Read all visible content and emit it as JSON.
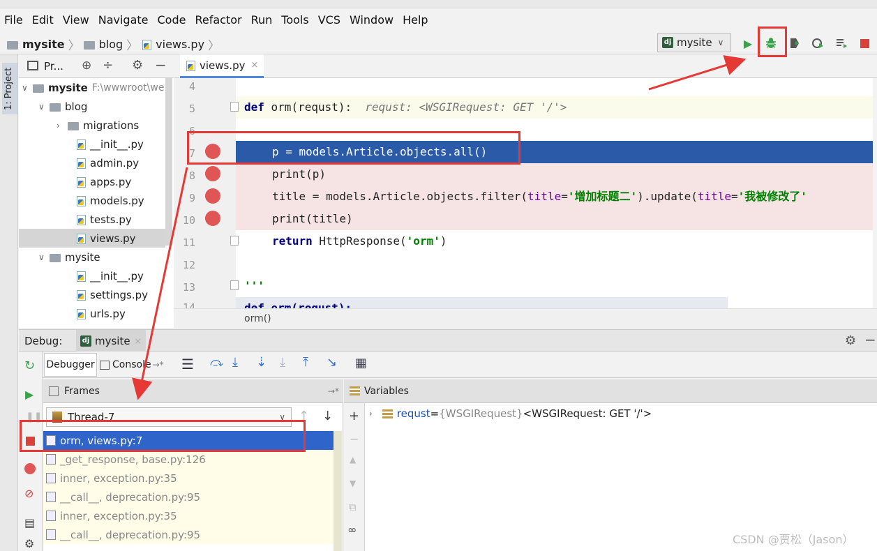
{
  "menu": [
    "File",
    "Edit",
    "View",
    "Navigate",
    "Code",
    "Refactor",
    "Run",
    "Tools",
    "VCS",
    "Window",
    "Help"
  ],
  "breadcrumb": {
    "root": "mysite",
    "folder": "blog",
    "file": "views.py"
  },
  "run_config": "mysite",
  "side_tab": "1: Project",
  "project_header": "Pr...",
  "tree": {
    "root": "mysite",
    "root_path": "F:\\wwwroot\\we",
    "blog": "blog",
    "blog_items": [
      "migrations",
      "__init__.py",
      "admin.py",
      "apps.py",
      "models.py",
      "tests.py",
      "views.py"
    ],
    "mysite": "mysite",
    "mysite_items": [
      "__init__.py",
      "settings.py",
      "urls.py"
    ]
  },
  "editor_tab": "views.py",
  "code": {
    "l4": "4",
    "l5": "5",
    "l6": "6",
    "l7": "7",
    "l8": "8",
    "l9": "9",
    "l10": "10",
    "l11": "11",
    "l12": "12",
    "l13": "13",
    "l14": "14",
    "def_kw": "def",
    "def_sig": " orm(requst):  ",
    "def_hint": "requst: <WSGIRequest: GET '/'>",
    "line7": "p = models.Article.objects.all()",
    "line8": "print(p)",
    "line9_a": "title = models.Article.objects.filter(",
    "line9_p1": "title",
    "line9_b": "=",
    "line9_s1": "'增加标题二'",
    "line9_c": ").update(",
    "line9_p2": "title",
    "line9_d": "=",
    "line9_s2": "'我被修改了'",
    "line10": "print(title)",
    "ret_kw": "return",
    "ret_rest": " HttpResponse(",
    "ret_str": "'orm'",
    "ret_end": ")",
    "line13": "'''",
    "line14": "def orm(requst):"
  },
  "status_crumb": "orm()",
  "debug": {
    "label": "Debug:",
    "config": "mysite",
    "tab_debugger": "Debugger",
    "tab_console": "Console"
  },
  "frames": {
    "header": "Frames",
    "thread": "Thread-7",
    "items": [
      "orm, views.py:7",
      "_get_response, base.py:126",
      "inner, exception.py:35",
      "__call__, deprecation.py:95",
      "inner, exception.py:35",
      "__call__, deprecation.py:95"
    ]
  },
  "variables": {
    "header": "Variables",
    "name": "requst",
    "eq": " = ",
    "type": "{WSGIRequest}",
    "value": " <WSGIRequest: GET '/'>"
  },
  "watermark": "CSDN @贾松（Jason）",
  "colors": {
    "breakpoint": "#e05555",
    "selection": "#2f65ca",
    "annotation": "#e53935"
  }
}
